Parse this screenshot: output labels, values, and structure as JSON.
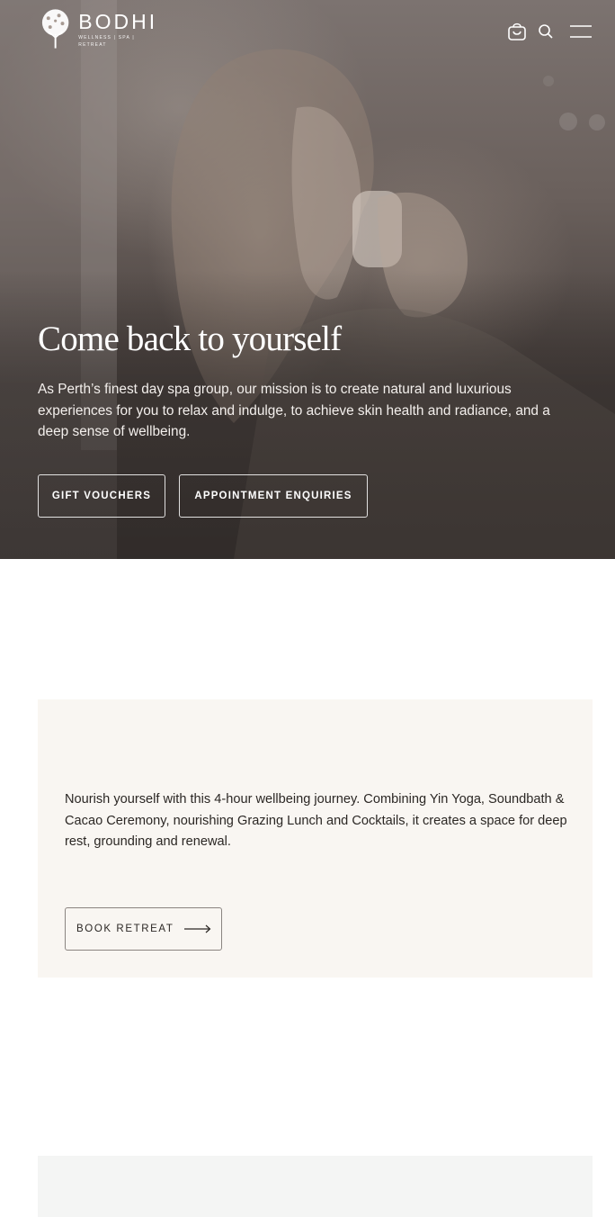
{
  "brand": {
    "name": "BODHI",
    "tagline": "WELLNESS | SPA | RETREAT"
  },
  "header": {
    "icons": [
      "shopping-bag-icon",
      "search-icon",
      "menu-icon"
    ]
  },
  "hero": {
    "title": "Come back to yourself",
    "text": "As Perth’s finest day spa group, our mission is to create natural and luxurious experiences for you to relax and indulge, to achieve skin health and radiance, and a deep sense of wellbeing.",
    "buttons": {
      "gift": "GIFT VOUCHERS",
      "appointment": "APPOINTMENT ENQUIRIES"
    }
  },
  "retreat": {
    "text": "Nourish yourself with this 4-hour wellbeing journey. Combining Yin Yoga, Soundbath & Cacao Ceremony, nourishing Grazing Lunch and Cocktails, it creates a space for deep rest, grounding and renewal.",
    "button": "BOOK RETREAT"
  },
  "colors": {
    "card_background": "#f9f6f2",
    "hero_text": "#ffffff",
    "body_text": "#2b2724"
  }
}
